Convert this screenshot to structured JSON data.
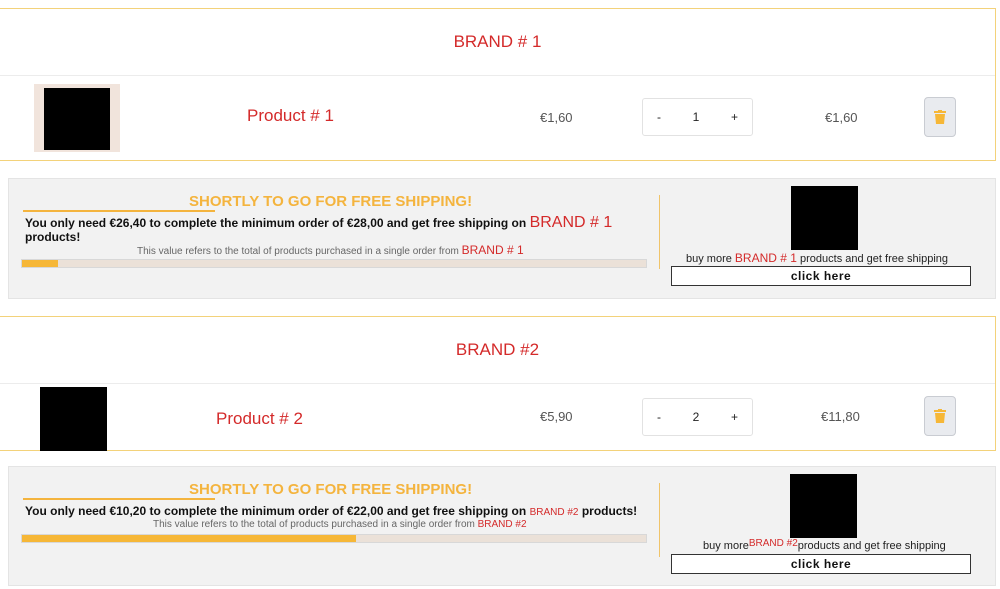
{
  "groups": [
    {
      "brand": "BRAND # 1",
      "product": {
        "name": "Product # 1",
        "unit_price": "€1,60",
        "quantity": "1",
        "total": "€1,60"
      },
      "shipping": {
        "title": "SHORTLY TO GO FOR FREE SHIPPING!",
        "message_before": "You only need €26,40 to complete the minimum order of €28,00 and get free shipping on",
        "message_brand": "BRAND # 1",
        "message_after": "products!",
        "note_before": "This value refers to the total of products purchased in a single order from",
        "note_brand": "BRAND # 1",
        "progress_fraction": 0.057,
        "promo_before": "buy more",
        "promo_brand": "BRAND # 1",
        "promo_after": "products and get free shipping",
        "button": "click here"
      }
    },
    {
      "brand": "BRAND #2",
      "product": {
        "name": "Product # 2",
        "unit_price": "€5,90",
        "quantity": "2",
        "total": "€11,80"
      },
      "shipping": {
        "title": "SHORTLY TO GO FOR FREE SHIPPING!",
        "message_before": "You only need €10,20 to complete the minimum order of €22,00 and get free shipping on",
        "message_brand": "BRAND #2",
        "message_after": "products!",
        "note_before": "This value refers to the total of products purchased in a single order from",
        "note_brand": "BRAND #2",
        "progress_fraction": 0.536,
        "promo_before": "buy more",
        "promo_brand": "BRAND #2",
        "promo_after": "products and get free shipping",
        "button": "click here"
      }
    }
  ],
  "qty_controls": {
    "minus": "-",
    "plus": "+"
  },
  "icons": {
    "delete": "trash-icon"
  },
  "colors": {
    "accent": "#f6b737",
    "brand_text": "#d42a2a",
    "border": "#f3d27a"
  }
}
